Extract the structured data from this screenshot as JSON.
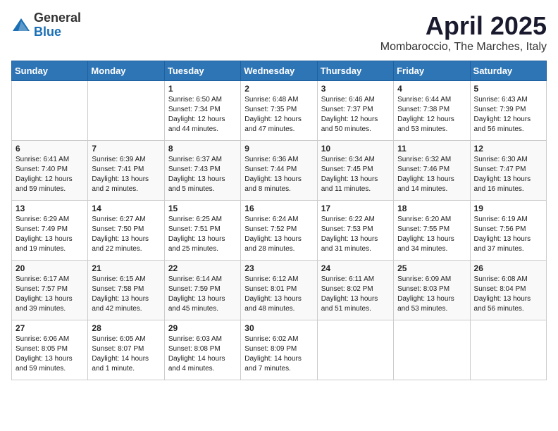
{
  "header": {
    "logo_general": "General",
    "logo_blue": "Blue",
    "month_title": "April 2025",
    "location": "Mombaroccio, The Marches, Italy"
  },
  "days_of_week": [
    "Sunday",
    "Monday",
    "Tuesday",
    "Wednesday",
    "Thursday",
    "Friday",
    "Saturday"
  ],
  "weeks": [
    [
      {
        "day": "",
        "content": ""
      },
      {
        "day": "",
        "content": ""
      },
      {
        "day": "1",
        "content": "Sunrise: 6:50 AM\nSunset: 7:34 PM\nDaylight: 12 hours and 44 minutes."
      },
      {
        "day": "2",
        "content": "Sunrise: 6:48 AM\nSunset: 7:35 PM\nDaylight: 12 hours and 47 minutes."
      },
      {
        "day": "3",
        "content": "Sunrise: 6:46 AM\nSunset: 7:37 PM\nDaylight: 12 hours and 50 minutes."
      },
      {
        "day": "4",
        "content": "Sunrise: 6:44 AM\nSunset: 7:38 PM\nDaylight: 12 hours and 53 minutes."
      },
      {
        "day": "5",
        "content": "Sunrise: 6:43 AM\nSunset: 7:39 PM\nDaylight: 12 hours and 56 minutes."
      }
    ],
    [
      {
        "day": "6",
        "content": "Sunrise: 6:41 AM\nSunset: 7:40 PM\nDaylight: 12 hours and 59 minutes."
      },
      {
        "day": "7",
        "content": "Sunrise: 6:39 AM\nSunset: 7:41 PM\nDaylight: 13 hours and 2 minutes."
      },
      {
        "day": "8",
        "content": "Sunrise: 6:37 AM\nSunset: 7:43 PM\nDaylight: 13 hours and 5 minutes."
      },
      {
        "day": "9",
        "content": "Sunrise: 6:36 AM\nSunset: 7:44 PM\nDaylight: 13 hours and 8 minutes."
      },
      {
        "day": "10",
        "content": "Sunrise: 6:34 AM\nSunset: 7:45 PM\nDaylight: 13 hours and 11 minutes."
      },
      {
        "day": "11",
        "content": "Sunrise: 6:32 AM\nSunset: 7:46 PM\nDaylight: 13 hours and 14 minutes."
      },
      {
        "day": "12",
        "content": "Sunrise: 6:30 AM\nSunset: 7:47 PM\nDaylight: 13 hours and 16 minutes."
      }
    ],
    [
      {
        "day": "13",
        "content": "Sunrise: 6:29 AM\nSunset: 7:49 PM\nDaylight: 13 hours and 19 minutes."
      },
      {
        "day": "14",
        "content": "Sunrise: 6:27 AM\nSunset: 7:50 PM\nDaylight: 13 hours and 22 minutes."
      },
      {
        "day": "15",
        "content": "Sunrise: 6:25 AM\nSunset: 7:51 PM\nDaylight: 13 hours and 25 minutes."
      },
      {
        "day": "16",
        "content": "Sunrise: 6:24 AM\nSunset: 7:52 PM\nDaylight: 13 hours and 28 minutes."
      },
      {
        "day": "17",
        "content": "Sunrise: 6:22 AM\nSunset: 7:53 PM\nDaylight: 13 hours and 31 minutes."
      },
      {
        "day": "18",
        "content": "Sunrise: 6:20 AM\nSunset: 7:55 PM\nDaylight: 13 hours and 34 minutes."
      },
      {
        "day": "19",
        "content": "Sunrise: 6:19 AM\nSunset: 7:56 PM\nDaylight: 13 hours and 37 minutes."
      }
    ],
    [
      {
        "day": "20",
        "content": "Sunrise: 6:17 AM\nSunset: 7:57 PM\nDaylight: 13 hours and 39 minutes."
      },
      {
        "day": "21",
        "content": "Sunrise: 6:15 AM\nSunset: 7:58 PM\nDaylight: 13 hours and 42 minutes."
      },
      {
        "day": "22",
        "content": "Sunrise: 6:14 AM\nSunset: 7:59 PM\nDaylight: 13 hours and 45 minutes."
      },
      {
        "day": "23",
        "content": "Sunrise: 6:12 AM\nSunset: 8:01 PM\nDaylight: 13 hours and 48 minutes."
      },
      {
        "day": "24",
        "content": "Sunrise: 6:11 AM\nSunset: 8:02 PM\nDaylight: 13 hours and 51 minutes."
      },
      {
        "day": "25",
        "content": "Sunrise: 6:09 AM\nSunset: 8:03 PM\nDaylight: 13 hours and 53 minutes."
      },
      {
        "day": "26",
        "content": "Sunrise: 6:08 AM\nSunset: 8:04 PM\nDaylight: 13 hours and 56 minutes."
      }
    ],
    [
      {
        "day": "27",
        "content": "Sunrise: 6:06 AM\nSunset: 8:05 PM\nDaylight: 13 hours and 59 minutes."
      },
      {
        "day": "28",
        "content": "Sunrise: 6:05 AM\nSunset: 8:07 PM\nDaylight: 14 hours and 1 minute."
      },
      {
        "day": "29",
        "content": "Sunrise: 6:03 AM\nSunset: 8:08 PM\nDaylight: 14 hours and 4 minutes."
      },
      {
        "day": "30",
        "content": "Sunrise: 6:02 AM\nSunset: 8:09 PM\nDaylight: 14 hours and 7 minutes."
      },
      {
        "day": "",
        "content": ""
      },
      {
        "day": "",
        "content": ""
      },
      {
        "day": "",
        "content": ""
      }
    ]
  ]
}
